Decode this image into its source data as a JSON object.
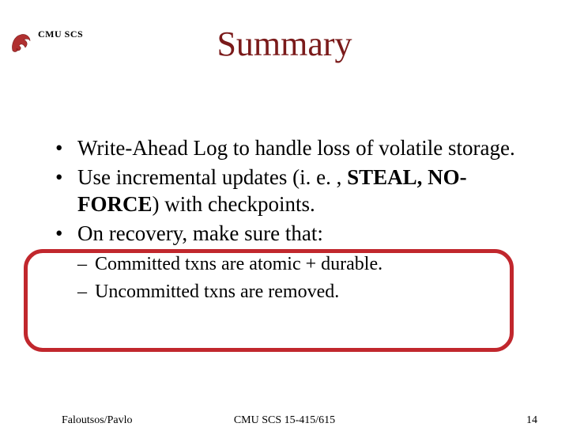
{
  "header": {
    "org": "CMU SCS"
  },
  "title": "Summary",
  "bullets": [
    {
      "text": "Write-Ahead Log to handle loss of volatile storage."
    },
    {
      "text_pre": "Use incremental updates (i. e. , ",
      "text_strong": "STEAL, NO-FORCE",
      "text_post": ") with checkpoints."
    },
    {
      "text": "On recovery, make sure that:"
    }
  ],
  "sublist": [
    "Committed txns are atomic + durable.",
    "Uncommitted txns are removed."
  ],
  "footer": {
    "left": "Faloutsos/Pavlo",
    "center": "CMU SCS 15-415/615",
    "right": "14"
  },
  "colors": {
    "title": "#7a1a1a",
    "highlight": "#c1272d"
  }
}
